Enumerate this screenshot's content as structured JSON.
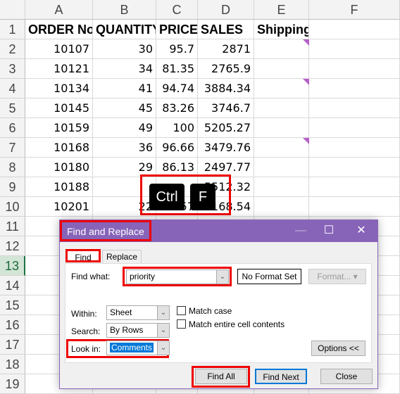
{
  "columns": [
    "A",
    "B",
    "C",
    "D",
    "E",
    "F"
  ],
  "rows": [
    "1",
    "2",
    "3",
    "4",
    "5",
    "6",
    "7",
    "8",
    "9",
    "10",
    "11",
    "12",
    "13",
    "14",
    "15",
    "16",
    "17",
    "18",
    "19"
  ],
  "headers": [
    "ORDER No.",
    "QUANTITY",
    "PRICE",
    "SALES",
    "Shipping"
  ],
  "data": [
    [
      "10107",
      "30",
      "95.7",
      "2871"
    ],
    [
      "10121",
      "34",
      "81.35",
      "2765.9"
    ],
    [
      "10134",
      "41",
      "94.74",
      "3884.34"
    ],
    [
      "10145",
      "45",
      "83.26",
      "3746.7"
    ],
    [
      "10159",
      "49",
      "100",
      "5205.27"
    ],
    [
      "10168",
      "36",
      "96.66",
      "3479.76"
    ],
    [
      "10180",
      "29",
      "86.13",
      "2497.77"
    ],
    [
      "10188",
      "",
      "",
      "5512.32"
    ],
    [
      "10201",
      "22",
      "98.57",
      "2168.54"
    ]
  ],
  "comment_color": "#b85fc9",
  "keys": [
    "Ctrl",
    "F"
  ],
  "dialog": {
    "title": "Find and Replace",
    "tabs": [
      "Find",
      "Replace"
    ],
    "find_what_label": "Find what:",
    "find_what_value": "priority",
    "no_format": "No Format Set",
    "format": "Format...",
    "within_label": "Within:",
    "within_value": "Sheet",
    "search_label": "Search:",
    "search_value": "By Rows",
    "lookin_label": "Look in:",
    "lookin_value": "Comments",
    "match_case": "Match case",
    "match_entire": "Match entire cell contents",
    "options": "Options <<",
    "find_all": "Find All",
    "find_next": "Find Next",
    "close": "Close",
    "title_color": "#8764b8"
  }
}
